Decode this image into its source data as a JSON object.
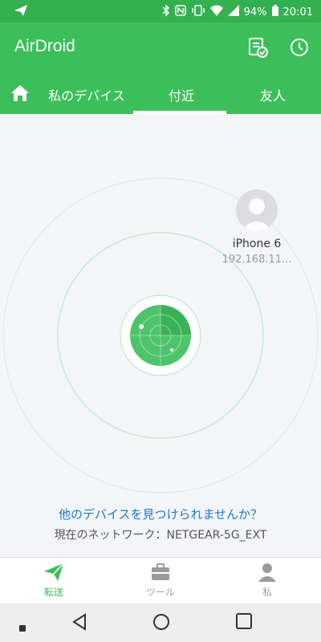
{
  "status": {
    "battery": "94%",
    "time": "20:01",
    "icons": [
      "airdroid-notify-icon",
      "bluetooth-icon",
      "nfc-icon",
      "vibrate-icon",
      "wifi-icon",
      "signal-icon",
      "battery-icon"
    ]
  },
  "appbar": {
    "title": "AirDroid",
    "icons": [
      "document-check-icon",
      "clock-icon"
    ]
  },
  "tabs": {
    "home_icon": "home-icon",
    "items": [
      "私のデバイス",
      "付近",
      "友人"
    ],
    "active_index": 1
  },
  "nearby": {
    "device": {
      "name": "iPhone 6",
      "ip": "192.168.11..."
    },
    "help_link": "他のデバイスを見つけられませんか？",
    "network": "現在のネットワーク：NETGEAR-5G_EXT"
  },
  "bottom_nav": {
    "items": [
      {
        "label": "転送",
        "icon": "send-icon",
        "active": true
      },
      {
        "label": "ツール",
        "icon": "briefcase-icon",
        "active": false
      },
      {
        "label": "私",
        "icon": "person-icon",
        "active": false
      }
    ]
  },
  "system_nav": {
    "icons": [
      "recent-dot-icon",
      "back-icon",
      "home-circle-icon",
      "overview-icon"
    ]
  },
  "colors": {
    "primary": "#3cbf5a",
    "statusbar": "#33b04f",
    "link": "#1a78c2"
  }
}
